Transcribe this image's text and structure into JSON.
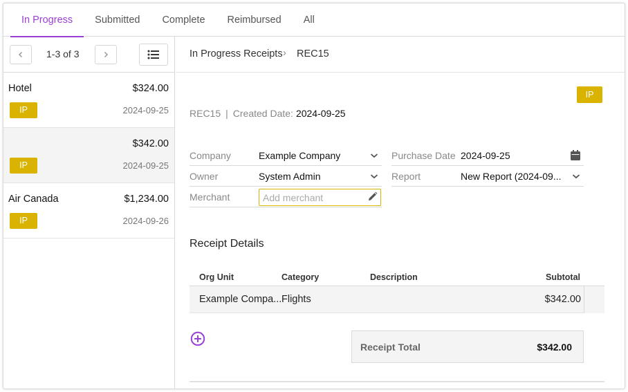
{
  "tabs": [
    {
      "label": "In Progress",
      "active": true
    },
    {
      "label": "Submitted"
    },
    {
      "label": "Complete"
    },
    {
      "label": "Reimbursed"
    },
    {
      "label": "All"
    }
  ],
  "pager": {
    "count": "1-3 of 3"
  },
  "receipts": [
    {
      "name": "Hotel",
      "amount": "$324.00",
      "badge": "IP",
      "date": "2024-09-25"
    },
    {
      "name": "",
      "amount": "$342.00",
      "badge": "IP",
      "date": "2024-09-25"
    },
    {
      "name": "Air Canada",
      "amount": "$1,234.00",
      "badge": "IP",
      "date": "2024-09-26"
    }
  ],
  "breadcrumb": {
    "parent": "In Progress Receipts",
    "separator": "›",
    "current": "REC15"
  },
  "detail": {
    "badge": "IP",
    "id": "REC15",
    "separator": "|",
    "created_label": "Created Date:",
    "created_value": "2024-09-25",
    "fields": {
      "company": {
        "label": "Company",
        "value": "Example Company"
      },
      "owner": {
        "label": "Owner",
        "value": "System Admin"
      },
      "merchant": {
        "label": "Merchant",
        "placeholder": "Add merchant"
      },
      "purchase_date": {
        "label": "Purchase Date",
        "value": "2024-09-25"
      },
      "report": {
        "label": "Report",
        "value": "New Report (2024-09..."
      }
    },
    "section_title": "Receipt Details",
    "table": {
      "headers": {
        "org_unit": "Org Unit",
        "category": "Category",
        "description": "Description",
        "subtotal": "Subtotal"
      },
      "rows": [
        {
          "org_unit": "Example Compa...",
          "category": "Flights",
          "description": "",
          "subtotal": "$342.00"
        }
      ]
    },
    "total": {
      "label": "Receipt Total",
      "value": "$342.00"
    }
  },
  "colors": {
    "accent": "#9b3fd6",
    "badge": "#d9b300"
  }
}
